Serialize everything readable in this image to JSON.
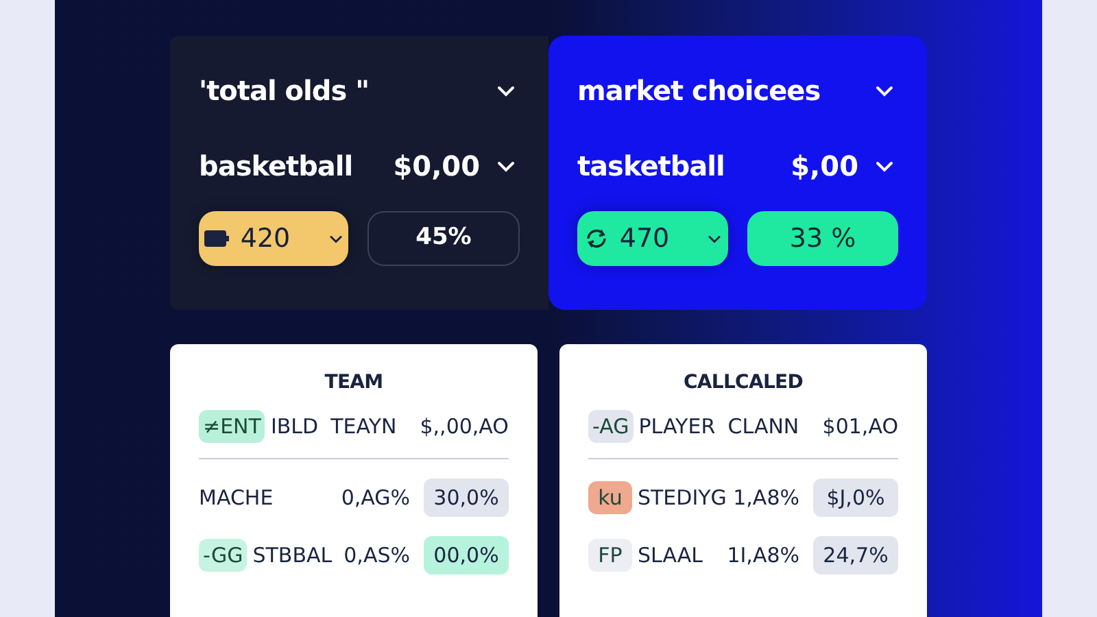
{
  "cards": [
    {
      "kind": "dark",
      "title": "'total olds \"",
      "row_label": "basketball",
      "amount": "$0,00",
      "chips": [
        {
          "kind": "dropdown",
          "value": "420",
          "color": "#f3c76b"
        },
        {
          "kind": "outline",
          "value": "45%"
        }
      ]
    },
    {
      "kind": "accent",
      "title": "market choicees",
      "row_label": "tasketball",
      "amount": "$,00",
      "chips": [
        {
          "kind": "dropdown",
          "value": "470",
          "color": "#1fe9a0"
        },
        {
          "kind": "filled",
          "value": "33 %",
          "color": "#1fe9a0"
        }
      ]
    }
  ],
  "tables": [
    {
      "title": "TEAM",
      "header": {
        "badge": {
          "label": "≠ENT",
          "color": "#b9f0d9"
        },
        "col_1": "IBLD",
        "col_2": "TEAYN",
        "col_3": "$,,00,AO"
      },
      "rows": [
        {
          "name": "MACHE",
          "pct": "0,AG%",
          "value": {
            "label": "30,0%",
            "color": "#e2e5ee"
          }
        },
        {
          "badge": {
            "label": "-GG",
            "color": "#c6f3e2"
          },
          "name": "STBBAL",
          "pct": "0,AS%",
          "value": {
            "label": "00,0%",
            "color": "#b6f2dc"
          }
        }
      ]
    },
    {
      "title": "CALLCALED",
      "header": {
        "badge": {
          "label": "-AG",
          "color": "#e2e5ee"
        },
        "col_1": "PLAYER",
        "col_2": "CLANN",
        "col_3": "$01,AO"
      },
      "rows": [
        {
          "badge": {
            "label": "ku",
            "color": "#eea98e"
          },
          "name": "STEDIYG",
          "pct": "1,A8%",
          "value": {
            "label": "$J,0%",
            "color": "#e2e5ee"
          }
        },
        {
          "badge": {
            "label": "FP",
            "color": "#eceef4"
          },
          "name": "SLAAL",
          "pct": "1I,A8%",
          "value": {
            "label": "24,7%",
            "color": "#e2e5ee"
          }
        }
      ]
    }
  ]
}
